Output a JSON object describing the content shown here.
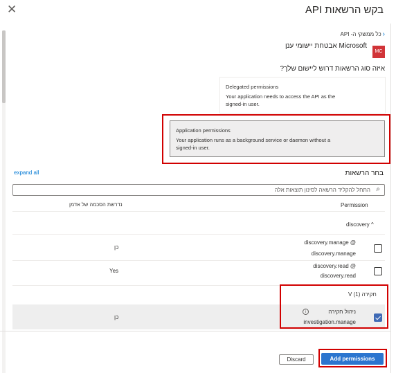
{
  "header": {
    "title": "בקש הרשאות API",
    "close_icon": "close-icon"
  },
  "breadcrumb": {
    "back_label": "כל ממשקי ה- API",
    "back_icon": "chevron-left-icon"
  },
  "api": {
    "logo_text": "MC",
    "name": "Microsoft אבטחת יישומי ענן"
  },
  "question": "איזה סוג הרשאות דרוש ליישום שלך?",
  "types": {
    "delegated": {
      "title": "Delegated permissions",
      "desc_line1": "Your application needs to access the API as the",
      "desc_line2": "signed-in user."
    },
    "application": {
      "title": "Application permissions",
      "desc_line1": "Your application runs as a background service or daemon without a",
      "desc_line2": "signed-in user."
    }
  },
  "select": {
    "label": "בחר הרשאות",
    "expand_all": "expand all",
    "search_placeholder": "התחל להקליד הרשאה לסינון תוצאות אלה",
    "search_icon": "search-icon"
  },
  "columns": {
    "permission": "Permission",
    "admin_consent": "נדרשת הסכמה של אדמן"
  },
  "groups": {
    "discovery": {
      "label": "discovery ^",
      "items": [
        {
          "name": "discovery.manage @",
          "value": "discovery.manage",
          "admin": "כן",
          "checked": false
        },
        {
          "name": "discovery.read @",
          "value": "discovery.read",
          "admin": "Yes",
          "checked": false
        }
      ]
    },
    "investigation": {
      "label": "חקירה (1) V",
      "items": [
        {
          "name": "ניהול חקירה",
          "value": "investigation.manage",
          "admin": "כן",
          "checked": true
        }
      ]
    }
  },
  "footer": {
    "add_label": "Add permissions",
    "discard_label": "Discard"
  },
  "colors": {
    "accent": "#0078d4",
    "button": "#2b75cf",
    "highlight": "#d10000",
    "logo": "#d13438"
  }
}
